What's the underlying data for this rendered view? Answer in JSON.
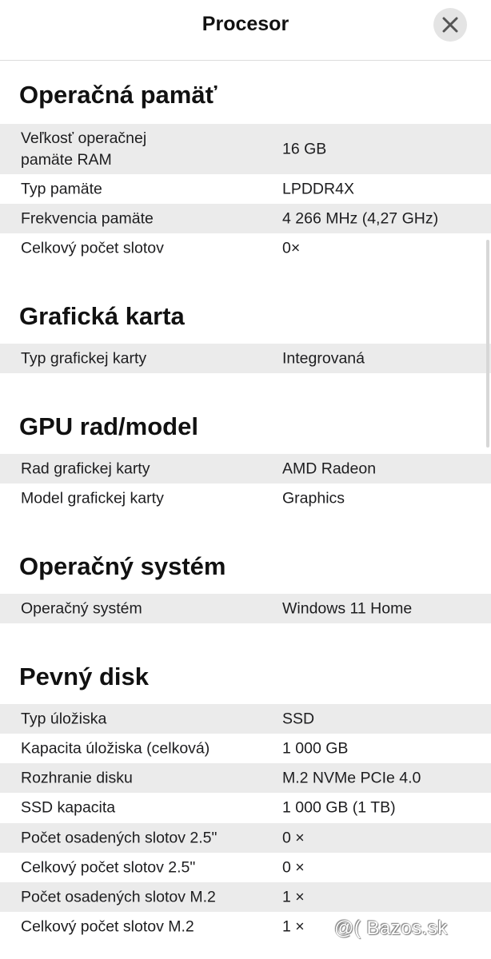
{
  "header": {
    "title": "Procesor"
  },
  "sections": [
    {
      "title": "Operačná pamäť",
      "rows": [
        {
          "key": "Veľkosť operačnej pamäte RAM",
          "value": "16 GB"
        },
        {
          "key": "Typ pamäte",
          "value": "LPDDR4X"
        },
        {
          "key": "Frekvencia pamäte",
          "value": "4 266 MHz (4,27 GHz)"
        },
        {
          "key": "Celkový počet slotov",
          "value": "0×"
        }
      ]
    },
    {
      "title": "Grafická karta",
      "rows": [
        {
          "key": "Typ grafickej karty",
          "value": "Integrovaná"
        }
      ]
    },
    {
      "title": "GPU rad/model",
      "rows": [
        {
          "key": "Rad grafickej karty",
          "value": "AMD Radeon"
        },
        {
          "key": "Model grafickej karty",
          "value": "Graphics"
        }
      ]
    },
    {
      "title": "Operačný systém",
      "rows": [
        {
          "key": "Operačný systém",
          "value": "Windows 11 Home"
        }
      ]
    },
    {
      "title": "Pevný disk",
      "rows": [
        {
          "key": "Typ úložiska",
          "value": "SSD"
        },
        {
          "key": "Kapacita úložiska (celková)",
          "value": "1 000 GB"
        },
        {
          "key": "Rozhranie disku",
          "value": "M.2 NVMe PCIe 4.0"
        },
        {
          "key": "SSD kapacita",
          "value": "1 000 GB (1 TB)"
        },
        {
          "key": "Počet osadených slotov 2.5\"",
          "value": "0 ×"
        },
        {
          "key": "Celkový počet slotov 2.5\"",
          "value": "0 ×"
        },
        {
          "key": "Počet osadených slotov M.2",
          "value": "1 ×"
        },
        {
          "key": "Celkový počet slotov M.2",
          "value": "1 ×"
        }
      ]
    }
  ],
  "watermark": {
    "text": "@( Bazos.sk"
  }
}
